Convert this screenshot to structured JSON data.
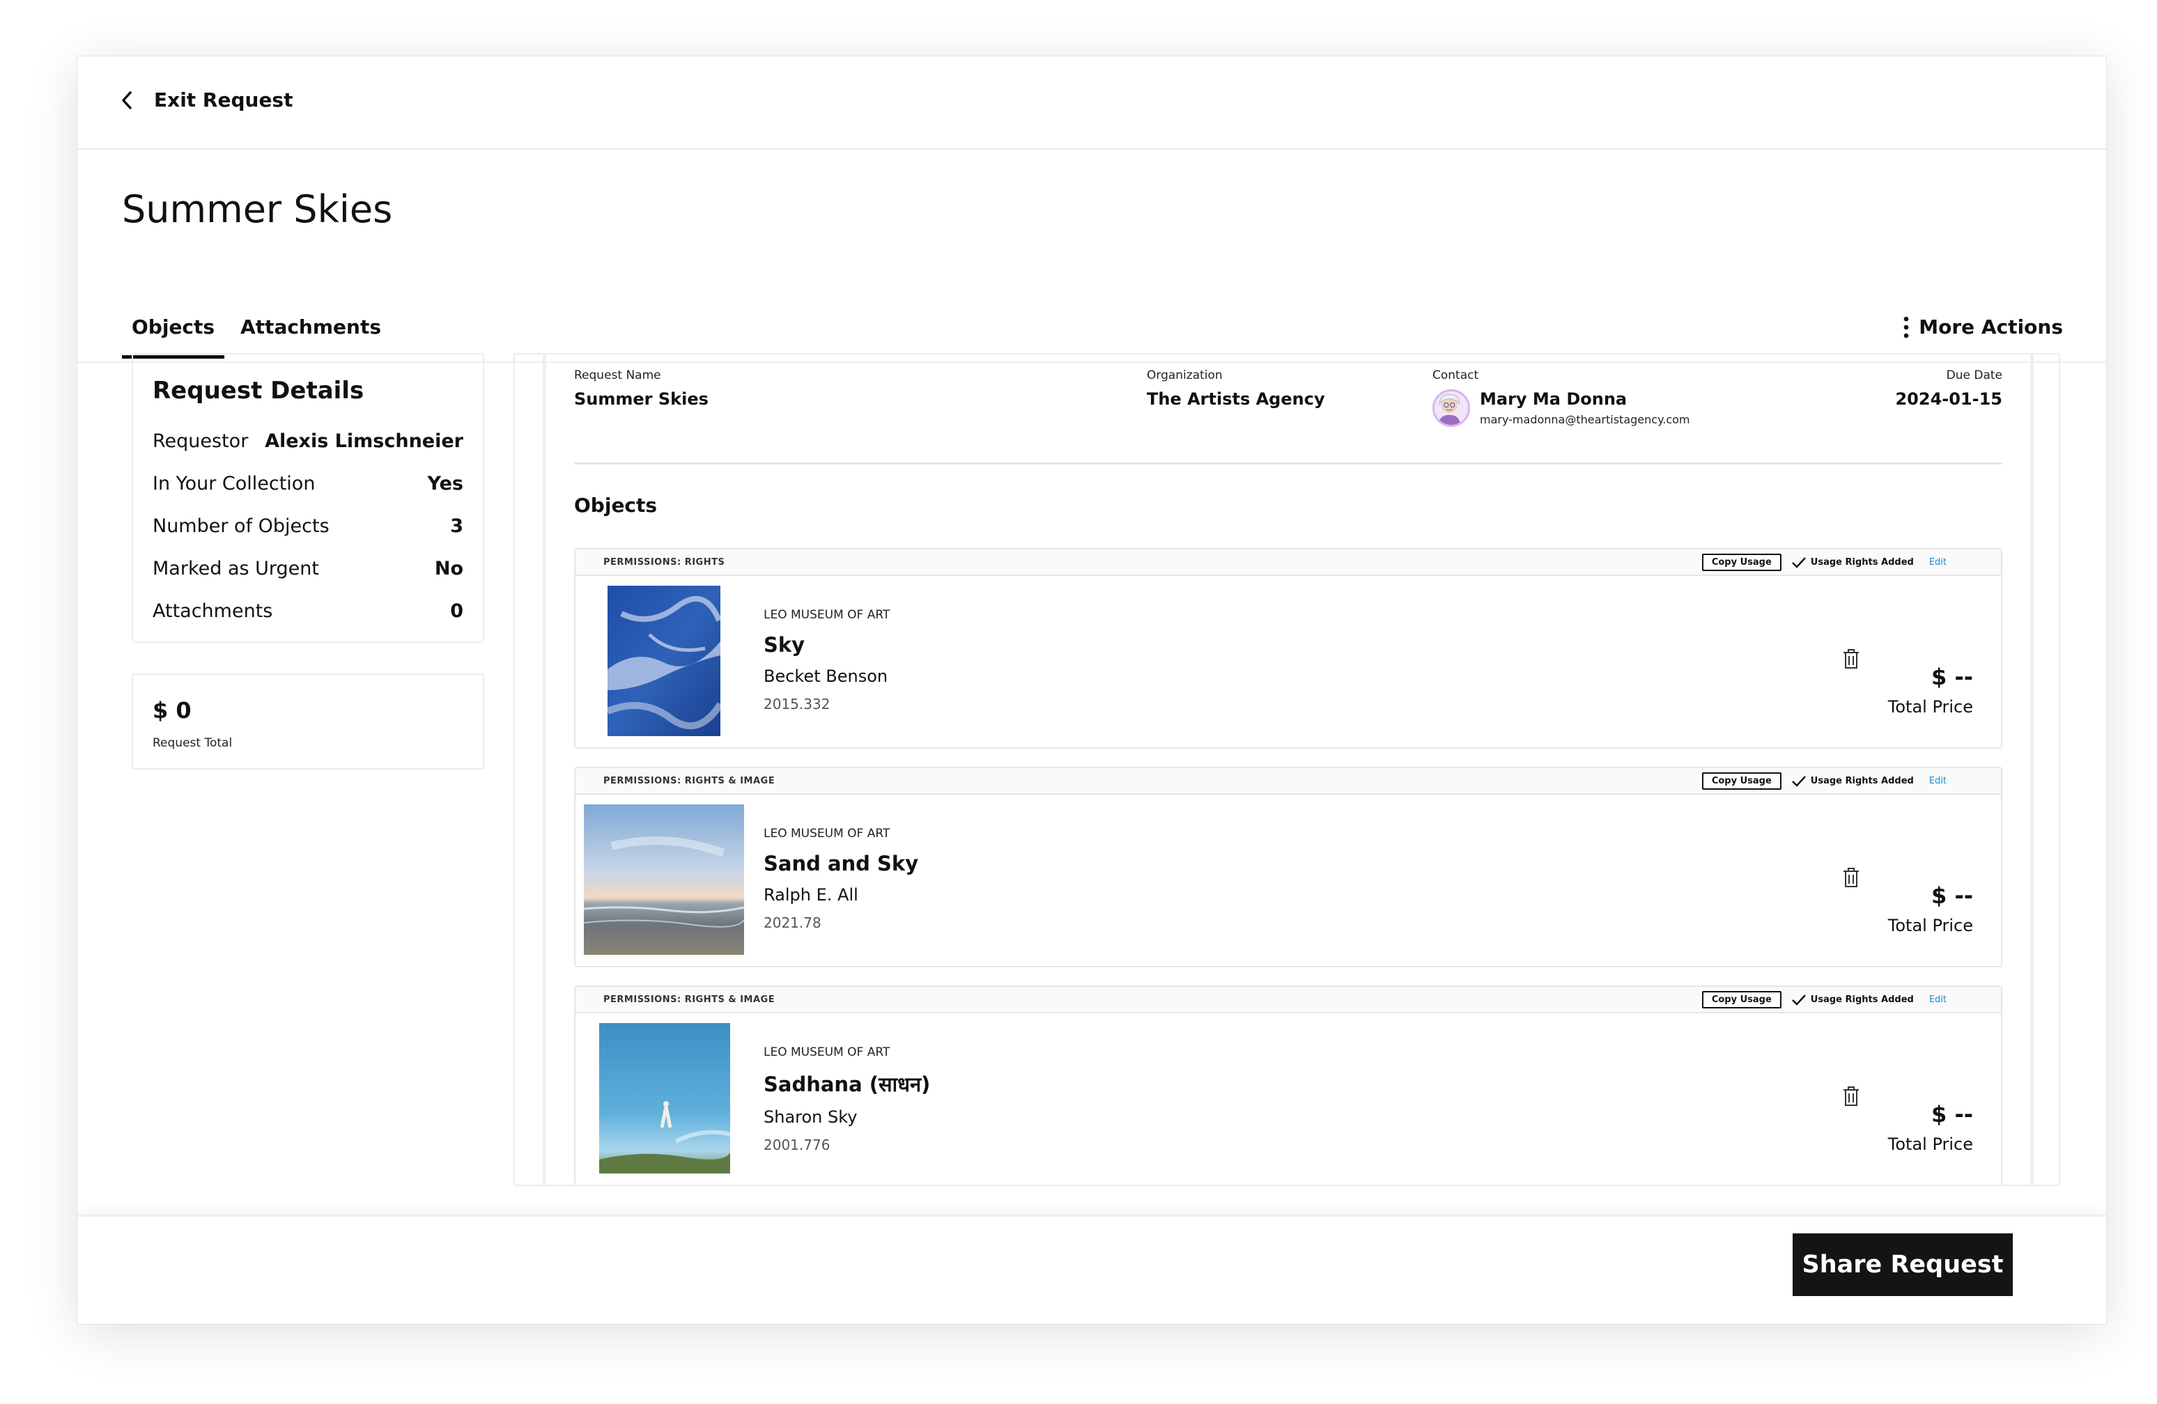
{
  "topbar": {
    "exit_label": "Exit Request"
  },
  "header": {
    "title": "Summer Skies",
    "tabs": [
      {
        "label": "Objects"
      },
      {
        "label": "Attachments"
      }
    ],
    "more_actions": "More Actions"
  },
  "details": {
    "title": "Request Details",
    "rows": [
      {
        "label": "Requestor",
        "value": "Alexis Limschneier"
      },
      {
        "label": "In Your Collection",
        "value": "Yes"
      },
      {
        "label": "Number of Objects",
        "value": "3"
      },
      {
        "label": "Marked as Urgent",
        "value": "No"
      },
      {
        "label": "Attachments",
        "value": "0"
      }
    ]
  },
  "total": {
    "amount": "$ 0",
    "label": "Request Total"
  },
  "meta": {
    "request_name_label": "Request Name",
    "request_name": "Summer Skies",
    "organization_label": "Organization",
    "organization": "The Artists Agency",
    "contact_label": "Contact",
    "contact_name": "Mary Ma Donna",
    "contact_email": "mary-madonna@theartistagency.com",
    "due_date_label": "Due Date",
    "due_date": "2024-01-15"
  },
  "objects_heading": "Objects",
  "card_actions": {
    "copy_usage": "Copy Usage",
    "usage_added": "Usage Rights Added",
    "edit": "Edit"
  },
  "objects": [
    {
      "permissions": "PERMISSIONS: RIGHTS",
      "museum": "LEO MUSEUM OF ART",
      "title": "Sky",
      "artist": "Becket Benson",
      "accession": "2015.332",
      "price": "$ --",
      "price_label": "Total Price"
    },
    {
      "permissions": "PERMISSIONS: RIGHTS & IMAGE",
      "museum": "LEO MUSEUM OF ART",
      "title": "Sand and Sky",
      "artist": "Ralph E. All",
      "accession": "2021.78",
      "price": "$ --",
      "price_label": "Total Price"
    },
    {
      "permissions": "PERMISSIONS: RIGHTS & IMAGE",
      "museum": "LEO MUSEUM OF ART",
      "title": "Sadhana (साधन)",
      "artist": "Sharon Sky",
      "accession": "2001.776",
      "price": "$ --",
      "price_label": "Total Price"
    }
  ],
  "footer": {
    "share_label": "Share Request"
  },
  "colors": {
    "primary": "#141414",
    "link": "#1b8ad6",
    "border": "#ececec"
  },
  "icons": [
    "chevron-left-icon",
    "kebab-menu-icon",
    "checkmark-icon",
    "trash-icon"
  ]
}
